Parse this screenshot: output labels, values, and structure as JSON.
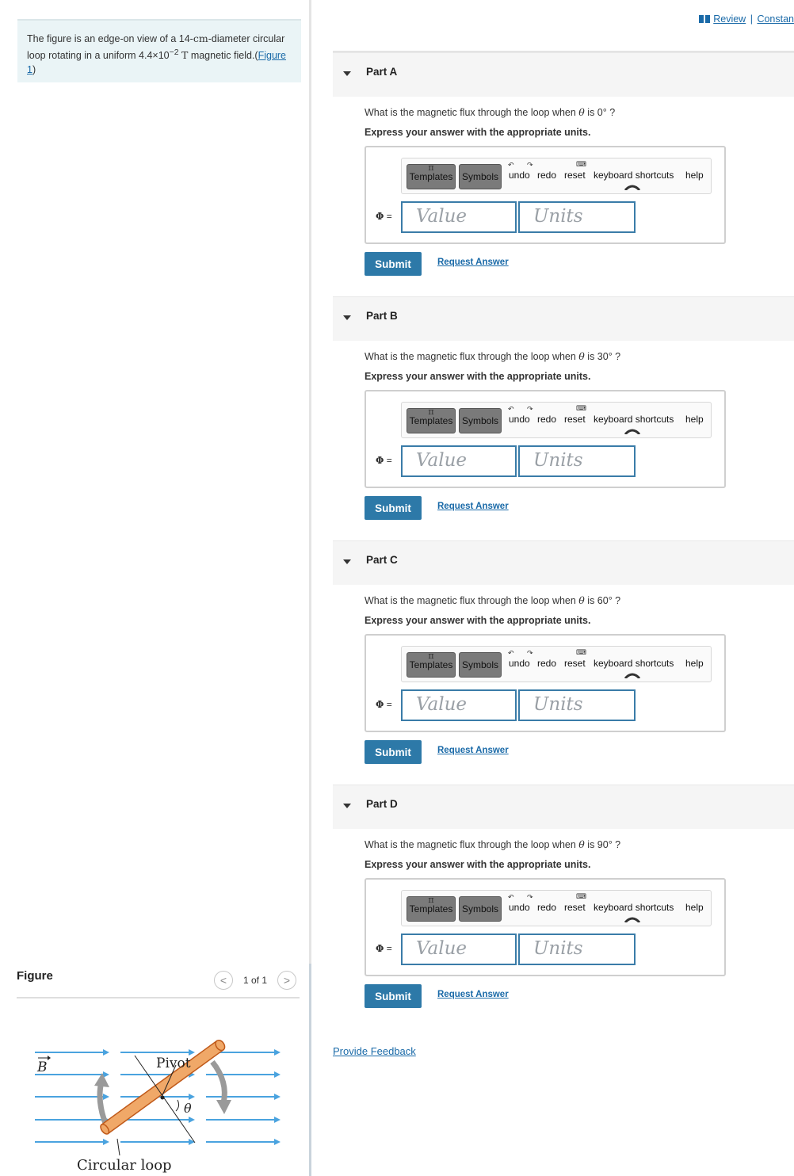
{
  "intro": {
    "text_before": "The figure is an edge-on view of a 14-",
    "unit_cm": "cm",
    "text_mid": "-diameter circular loop rotating in a uniform 4.4×10",
    "exponent": "−2",
    "unit_T": "T",
    "text_after": " magnetic field.(",
    "figure_link": "Figure 1",
    "close": ")"
  },
  "header": {
    "review_label": "Review",
    "separator": "|",
    "constants_label": "Constan"
  },
  "figure_panel": {
    "label": "Figure",
    "count": "1 of 1",
    "prev_glyph": "<",
    "next_glyph": ">",
    "labels": {
      "b_field": "B",
      "pivot": "Pivot",
      "theta": "θ",
      "loop": "Circular loop"
    },
    "colors": {
      "field_lines": "#4aa3df",
      "loop_fill": "#f0a868",
      "loop_edge": "#c05a1a",
      "rotation_arrow": "#9a9a9a"
    }
  },
  "toolbar": {
    "templates": "Templates",
    "symbols": "Symbols",
    "undo": "undo",
    "redo": "redo",
    "reset": "reset",
    "shortcuts": "keyboard shortcuts",
    "help": "help",
    "pi_glyph": "π"
  },
  "parts": [
    {
      "title": "Part A",
      "q_before": "What is the magnetic flux through the loop when ",
      "theta": "θ",
      "q_after": " is 0° ?",
      "instruction": "Express your answer with the appropriate units.",
      "phi": "Φ",
      "equals": " =",
      "value_placeholder": "Value",
      "units_placeholder": "Units",
      "submit": "Submit",
      "request": "Request Answer"
    },
    {
      "title": "Part B",
      "q_before": "What is the magnetic flux through the loop when ",
      "theta": "θ",
      "q_after": " is 30° ?",
      "instruction": "Express your answer with the appropriate units.",
      "phi": "Φ",
      "equals": " =",
      "value_placeholder": "Value",
      "units_placeholder": "Units",
      "submit": "Submit",
      "request": "Request Answer"
    },
    {
      "title": "Part C",
      "q_before": "What is the magnetic flux through the loop when ",
      "theta": "θ",
      "q_after": " is 60° ?",
      "instruction": "Express your answer with the appropriate units.",
      "phi": "Φ",
      "equals": " =",
      "value_placeholder": "Value",
      "units_placeholder": "Units",
      "submit": "Submit",
      "request": "Request Answer"
    },
    {
      "title": "Part D",
      "q_before": "What is the magnetic flux through the loop when ",
      "theta": "θ",
      "q_after": " is 90° ?",
      "instruction": "Express your answer with the appropriate units.",
      "phi": "Φ",
      "equals": " =",
      "value_placeholder": "Value",
      "units_placeholder": "Units",
      "submit": "Submit",
      "request": "Request Answer"
    }
  ],
  "feedback": "Provide Feedback"
}
